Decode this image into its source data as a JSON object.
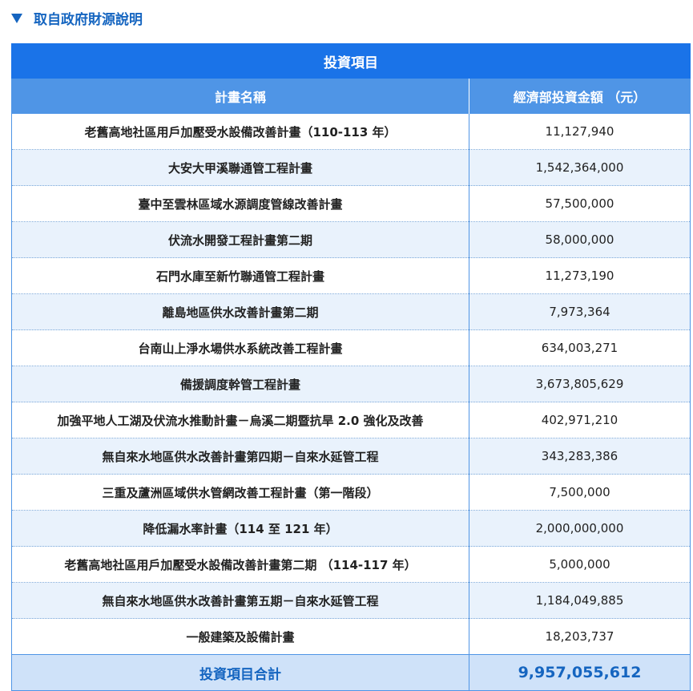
{
  "section": {
    "toggle_label": "取自政府財源說明"
  },
  "table": {
    "title": "投資項目",
    "headers": {
      "name": "計畫名稱",
      "amount": "經濟部投資金額 （元）"
    },
    "rows": [
      {
        "name": "老舊高地社區用戶加壓受水設備改善計畫（110-113 年）",
        "amount": "11,127,940"
      },
      {
        "name": "大安大甲溪聯通管工程計畫",
        "amount": "1,542,364,000"
      },
      {
        "name": "臺中至雲林區域水源調度管線改善計畫",
        "amount": "57,500,000"
      },
      {
        "name": "伏流水開發工程計畫第二期",
        "amount": "58,000,000"
      },
      {
        "name": "石門水庫至新竹聯通管工程計畫",
        "amount": "11,273,190"
      },
      {
        "name": "離島地區供水改善計畫第二期",
        "amount": "7,973,364"
      },
      {
        "name": "台南山上淨水場供水系統改善工程計畫",
        "amount": "634,003,271"
      },
      {
        "name": "備援調度幹管工程計畫",
        "amount": "3,673,805,629"
      },
      {
        "name": "加強平地人工湖及伏流水推動計畫－烏溪二期暨抗旱 2.0 強化及改善",
        "amount": "402,971,210"
      },
      {
        "name": "無自來水地區供水改善計畫第四期－自來水延管工程",
        "amount": "343,283,386"
      },
      {
        "name": "三重及蘆洲區域供水管網改善工程計畫（第一階段）",
        "amount": "7,500,000"
      },
      {
        "name": "降低漏水率計畫（114 至 121 年）",
        "amount": "2,000,000,000"
      },
      {
        "name": "老舊高地社區用戶加壓受水設備改善計畫第二期 （114-117 年）",
        "amount": "5,000,000"
      },
      {
        "name": "無自來水地區供水改善計畫第五期－自來水延管工程",
        "amount": "1,184,049,885"
      },
      {
        "name": "一般建築及設備計畫",
        "amount": "18,203,737"
      }
    ],
    "total": {
      "label": "投資項目合計",
      "amount": "9,957,055,612"
    }
  },
  "colors": {
    "accent": "#1565c0",
    "title_bg": "#1a73e8",
    "header_bg": "#4f95e6",
    "stripe_bg": "#e9f2fc",
    "total_bg": "#cfe2f9"
  },
  "icons": {
    "toggle": "triangle-down-icon"
  }
}
